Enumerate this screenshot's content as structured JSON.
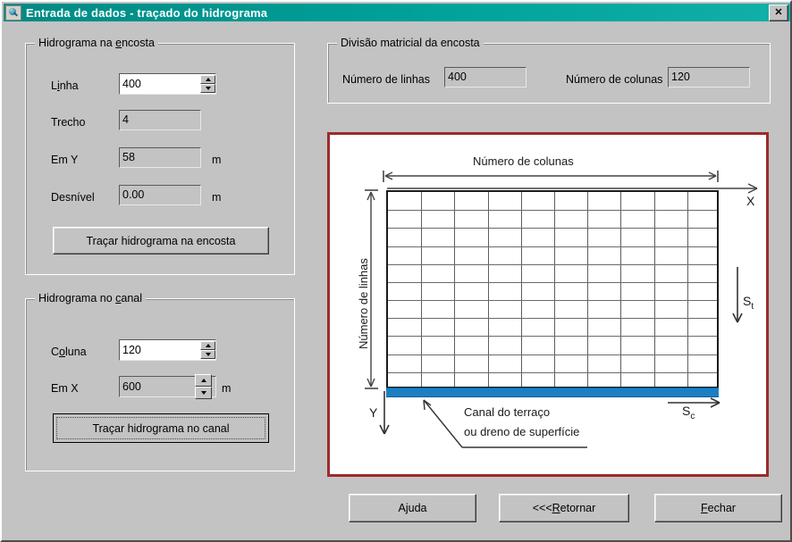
{
  "window": {
    "title": "Entrada de dados - traçado do hidrograma",
    "icon": "app-magnifier-icon",
    "close_label": "✕",
    "titlebar_color": "#00a29b"
  },
  "group_encosta": {
    "legend_pre": "Hidrograma na ",
    "legend_mnemonic": "e",
    "legend_post": "ncosta",
    "fields": [
      {
        "label_pre": "L",
        "label_mnemonic": "i",
        "label_post": "nha",
        "value": "400",
        "unit": "",
        "spinner": true,
        "enabled": true
      },
      {
        "label_pre": "Trecho",
        "label_mnemonic": "",
        "label_post": "",
        "value": "4",
        "unit": "",
        "spinner": false,
        "enabled": false
      },
      {
        "label_pre": "Em Y",
        "label_mnemonic": "",
        "label_post": "",
        "value": "58",
        "unit": "m",
        "spinner": false,
        "enabled": false
      },
      {
        "label_pre": "Desnível",
        "label_mnemonic": "",
        "label_post": "",
        "value": "0.00",
        "unit": "m",
        "spinner": false,
        "enabled": false
      }
    ],
    "button_label": "Traçar hidrograma na encosta"
  },
  "group_canal": {
    "legend_pre": "Hidrograma no ",
    "legend_mnemonic": "c",
    "legend_post": "anal",
    "fields": [
      {
        "label_pre": "C",
        "label_mnemonic": "o",
        "label_post": "luna",
        "value": "120",
        "unit": "",
        "spinner": true,
        "enabled": true
      },
      {
        "label_pre": "Em X",
        "label_mnemonic": "",
        "label_post": "",
        "value": "600",
        "unit": "m",
        "spinner": true,
        "enabled": false
      }
    ],
    "button_label": "Traçar hidrograma no canal"
  },
  "group_divisao": {
    "legend": "Divisão matricial da encosta",
    "rows_label": "Número de linhas",
    "rows_value": "400",
    "cols_label": "Número de colunas",
    "cols_value": "120"
  },
  "diagram": {
    "border_color": "#9b2b2b",
    "channel_color": "#1b7fc4",
    "top_label": "Número de colunas",
    "left_label": "Número de linhas",
    "x_axis": "X",
    "y_axis": "Y",
    "slope_terrain": "S",
    "slope_terrain_sub": "t",
    "slope_channel": "S",
    "slope_channel_sub": "c",
    "callout_line1": "Canal do terraço",
    "callout_line2": "ou dreno de superfície",
    "grid_columns": 10,
    "grid_rows": 11
  },
  "footer": {
    "help_pre": "A",
    "help_mnemonic": "j",
    "help_post": "uda",
    "back_pre": "<<< ",
    "back_mnemonic": "R",
    "back_post": "etornar",
    "close_pre": "",
    "close_mnemonic": "F",
    "close_post": "echar"
  }
}
